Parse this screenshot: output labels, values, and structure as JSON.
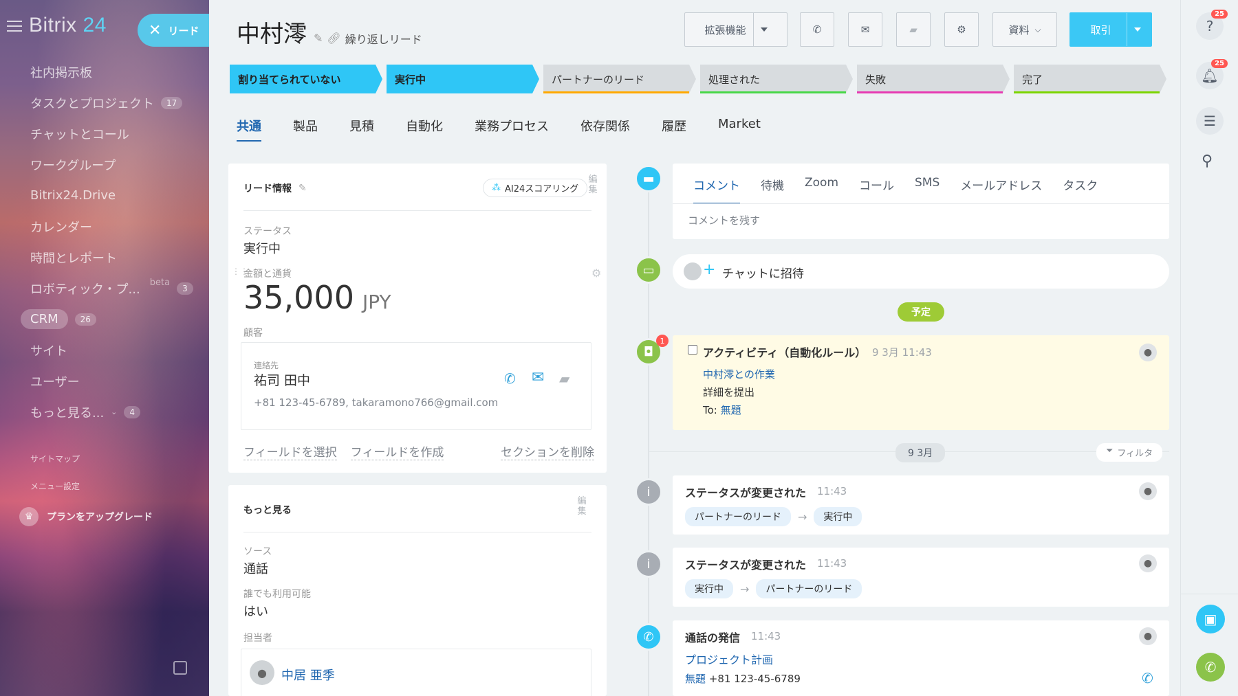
{
  "sidebar": {
    "logo_text": "Bitrix",
    "logo_num": "24",
    "lead_pill": "リード",
    "items": [
      {
        "label": "社内掲示板"
      },
      {
        "label": "タスクとプロジェクト",
        "count": "17"
      },
      {
        "label": "チャットとコール"
      },
      {
        "label": "ワークグループ"
      },
      {
        "label": "Bitrix24.Drive"
      },
      {
        "label": "カレンダー"
      },
      {
        "label": "時間とレポート"
      },
      {
        "label": "ロボティック・プ...",
        "beta": "beta",
        "count": "3"
      },
      {
        "label": "CRM",
        "count": "26"
      },
      {
        "label": "サイト"
      },
      {
        "label": "ユーザー"
      },
      {
        "label": "もっと見る...",
        "count": "4"
      }
    ],
    "sitemap": "サイトマップ",
    "menu_settings": "メニュー設定",
    "upgrade": "プランをアップグレード"
  },
  "header": {
    "title": "中村澪",
    "repeat_lead": "繰り返しリード",
    "ext_button": "拡張機能",
    "docs_button": "資料",
    "deal_button": "取引"
  },
  "stages": [
    {
      "label": "割り当てられていない",
      "color": "#2fc6f6",
      "active": true
    },
    {
      "label": "実行中",
      "color": "#2fc6f6",
      "active": true
    },
    {
      "label": "パートナーのリード",
      "color": "#ffa900"
    },
    {
      "label": "処理された",
      "color": "#47d747"
    },
    {
      "label": "失敗",
      "color": "#e63ab2"
    },
    {
      "label": "完了",
      "color": "#7bd500"
    }
  ],
  "tabs": [
    "共通",
    "製品",
    "見積",
    "自動化",
    "業務プロセス",
    "依存関係",
    "履歴",
    "Market"
  ],
  "lead_info": {
    "title": "リード情報",
    "ai_scoring": "AI24スコアリング",
    "edit": "編集",
    "status_label": "ステータス",
    "status_value": "実行中",
    "amount_label": "金額と通貨",
    "amount": "35,000",
    "currency": "JPY",
    "customer_label": "顧客",
    "contact_label": "連絡先",
    "contact_name": "祐司 田中",
    "contact_details": "+81 123-45-6789, takaramono766@gmail.com",
    "select_field": "フィールドを選択",
    "create_field": "フィールドを作成",
    "delete_section": "セクションを削除"
  },
  "more": {
    "title": "もっと見る",
    "edit": "編集",
    "source_label": "ソース",
    "source_value": "通話",
    "available_label": "誰でも利用可能",
    "available_value": "はい",
    "assignee_label": "担当者",
    "assignee_name": "中居 亜季"
  },
  "timeline": {
    "comment_tabs": [
      "コメント",
      "待機",
      "Zoom",
      "コール",
      "SMS",
      "メールアドレス",
      "タスク"
    ],
    "comment_placeholder": "コメントを残す",
    "invite_chat": "チャットに招待",
    "planned": "予定",
    "activity": {
      "badge": "1",
      "title": "アクティビティ（自動化ルール）",
      "time": "9 3月 11:43",
      "link": "中村澪との作業",
      "desc": "詳細を提出",
      "to_label": "To:",
      "to_value": "無題"
    },
    "date_sep": "9 3月",
    "filter": "フィルタ",
    "events": [
      {
        "title": "ステータスが変更された",
        "time": "11:43",
        "from": "パートナーのリード",
        "to": "実行中"
      },
      {
        "title": "ステータスが変更された",
        "time": "11:43",
        "from": "実行中",
        "to": "パートナーのリード"
      }
    ],
    "call": {
      "title": "通話の発信",
      "time": "11:43",
      "link": "プロジェクト計画",
      "who": "無題",
      "phone": "+81 123-45-6789"
    }
  },
  "right_bar": {
    "help_badge": "25",
    "bell_badge": "25"
  }
}
